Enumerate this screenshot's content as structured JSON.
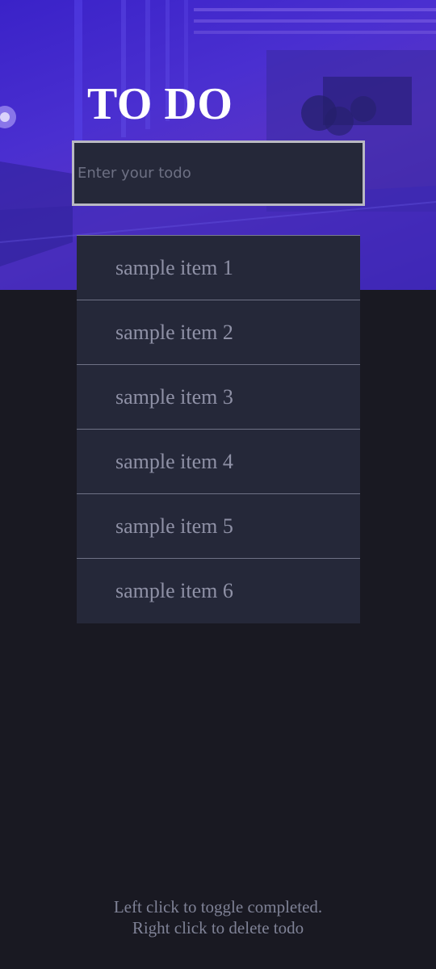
{
  "header": {
    "title": "TO DO",
    "background_image": "night-street-photo"
  },
  "input": {
    "placeholder": "Enter your todo",
    "value": ""
  },
  "todos": [
    {
      "label": "sample item 1"
    },
    {
      "label": "sample item 2"
    },
    {
      "label": "sample item 3"
    },
    {
      "label": "sample item 4"
    },
    {
      "label": "sample item 5"
    },
    {
      "label": "sample item 6"
    }
  ],
  "footer": {
    "line1": "Left click to toggle completed.",
    "line2": "Right click to delete todo"
  },
  "colors": {
    "background": "#191922",
    "hero_tint": "#4a2fd0",
    "item_background": "#252839",
    "item_text": "#8f91a6",
    "title_text": "#ffffff"
  }
}
